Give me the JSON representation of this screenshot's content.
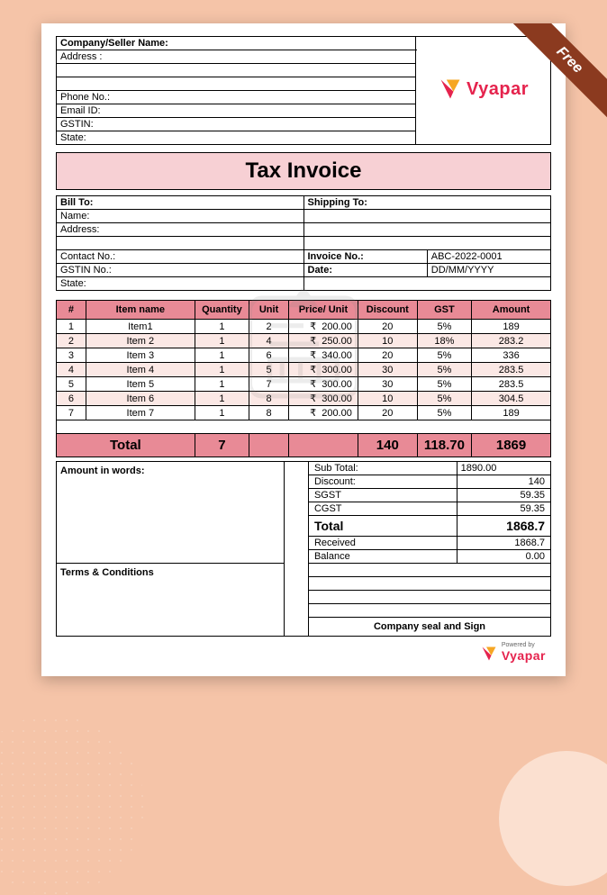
{
  "ribbon": "Free",
  "brand": "Vyapar",
  "powered_by": "Powered by",
  "seller": {
    "company_label": "Company/Seller Name:",
    "address_label": "Address :",
    "phone_label": "Phone No.:",
    "email_label": "Email ID:",
    "gstin_label": "GSTIN:",
    "state_label": "State:"
  },
  "title": "Tax Invoice",
  "billto": {
    "heading": "Bill To:",
    "name_label": "Name:",
    "address_label": "Address:",
    "contact_label": "Contact No.:",
    "gstin_label": "GSTIN No.:",
    "state_label": "State:"
  },
  "shipto": {
    "heading": "Shipping To:",
    "invoice_no_label": "Invoice No.:",
    "invoice_no_value": "ABC-2022-0001",
    "date_label": "Date:",
    "date_value": "DD/MM/YYYY"
  },
  "items_header": {
    "num": "#",
    "name": "Item name",
    "qty": "Quantity",
    "unit": "Unit",
    "price": "Price/ Unit",
    "discount": "Discount",
    "gst": "GST",
    "amount": "Amount"
  },
  "currency": "₹",
  "items": [
    {
      "num": "1",
      "name": "Item1",
      "qty": "1",
      "unit": "2",
      "price": "200.00",
      "discount": "20",
      "gst": "5%",
      "amount": "189"
    },
    {
      "num": "2",
      "name": "Item 2",
      "qty": "1",
      "unit": "4",
      "price": "250.00",
      "discount": "10",
      "gst": "18%",
      "amount": "283.2"
    },
    {
      "num": "3",
      "name": "Item 3",
      "qty": "1",
      "unit": "6",
      "price": "340.00",
      "discount": "20",
      "gst": "5%",
      "amount": "336"
    },
    {
      "num": "4",
      "name": "Item 4",
      "qty": "1",
      "unit": "5",
      "price": "300.00",
      "discount": "30",
      "gst": "5%",
      "amount": "283.5"
    },
    {
      "num": "5",
      "name": "Item 5",
      "qty": "1",
      "unit": "7",
      "price": "300.00",
      "discount": "30",
      "gst": "5%",
      "amount": "283.5"
    },
    {
      "num": "6",
      "name": "Item 6",
      "qty": "1",
      "unit": "8",
      "price": "300.00",
      "discount": "10",
      "gst": "5%",
      "amount": "304.5"
    },
    {
      "num": "7",
      "name": "Item 7",
      "qty": "1",
      "unit": "8",
      "price": "200.00",
      "discount": "20",
      "gst": "5%",
      "amount": "189"
    }
  ],
  "totals_row": {
    "label": "Total",
    "qty": "7",
    "discount": "140",
    "gst": "118.70",
    "amount": "1869"
  },
  "left_block": {
    "amount_in_words": "Amount in words:",
    "terms": "Terms & Conditions"
  },
  "summary": {
    "subtotal_label": "Sub Total:",
    "subtotal_value": "1890.00",
    "discount_label": "Discount:",
    "discount_value": "140",
    "sgst_label": "SGST",
    "sgst_value": "59.35",
    "cgst_label": "CGST",
    "cgst_value": "59.35",
    "total_label": "Total",
    "total_value": "1868.7",
    "received_label": "Received",
    "received_value": "1868.7",
    "balance_label": "Balance",
    "balance_value": "0.00"
  },
  "sign": "Company seal and Sign"
}
